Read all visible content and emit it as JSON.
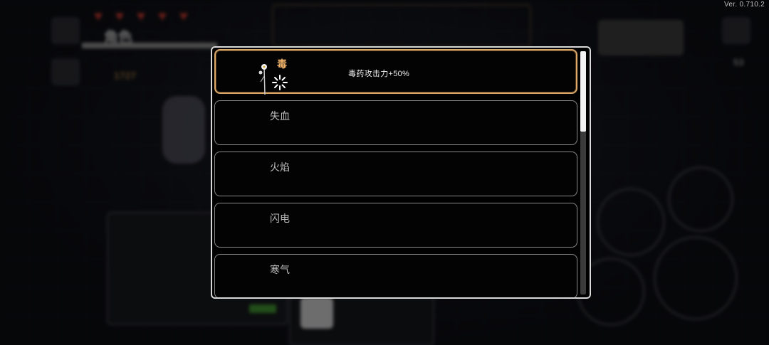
{
  "version": "Ver. 0.710.2",
  "background": {
    "tab_label": "角色",
    "hearts": [
      "♥",
      "♥",
      "♥",
      "♥",
      "♥"
    ],
    "gold_count": "1727",
    "enemy_count": "53"
  },
  "modal": {
    "items": [
      {
        "title": "毒",
        "description": "毒药攻击力+50%",
        "selected": true,
        "icon": "flower-icon"
      },
      {
        "title": "失血",
        "description": "",
        "selected": false
      },
      {
        "title": "火焰",
        "description": "",
        "selected": false
      },
      {
        "title": "闪电",
        "description": "",
        "selected": false
      },
      {
        "title": "寒气",
        "description": "",
        "selected": false
      }
    ],
    "scrollbar": {
      "thumb_fraction": 0.33,
      "position": 0
    }
  },
  "colors": {
    "selected_border": "#d9a86a",
    "selected_title": "#f0b36a",
    "row_border": "#8a8a8a",
    "modal_border": "#d9d9d9",
    "heart": "#b5352d"
  }
}
